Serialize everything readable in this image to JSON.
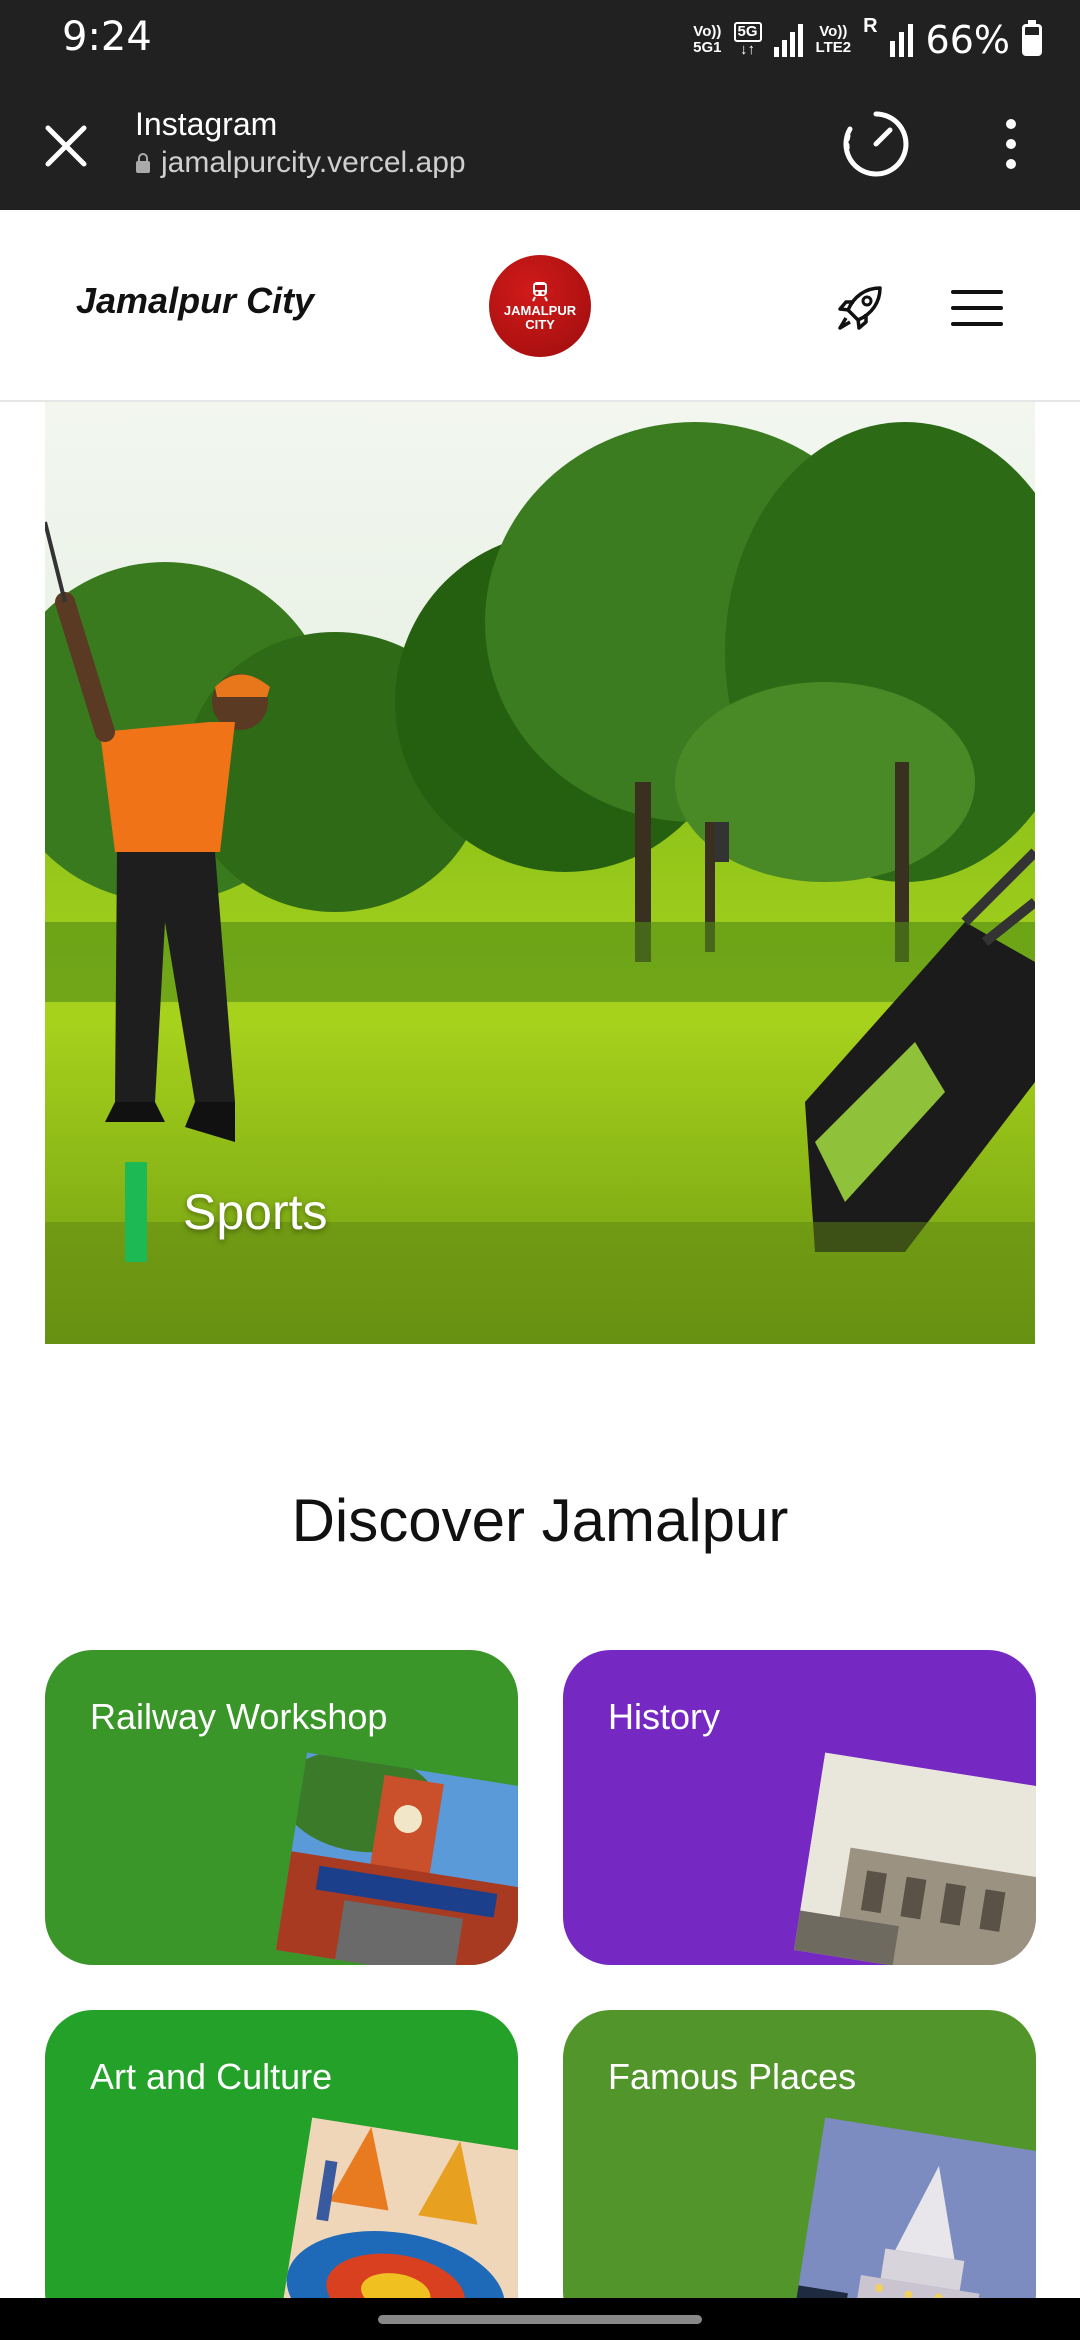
{
  "status": {
    "time": "9:24",
    "net1_top": "Vo))",
    "net1_bottom": "5G1",
    "net2_top": "5G",
    "net2_bottom": "↓↑",
    "net3_top": "Vo))",
    "net3_bottom": "LTE2",
    "roaming": "R",
    "battery": "66%"
  },
  "browser": {
    "title": "Instagram",
    "url": "jamalpurcity.vercel.app"
  },
  "header": {
    "brand": "Jamalpur City",
    "logo_line1": "JAMALPUR",
    "logo_line2": "CITY",
    "brand_color": "#b31212"
  },
  "hero": {
    "label": "Sports",
    "accent": "#1db954"
  },
  "discover": {
    "title": "Discover Jamalpur",
    "cards": [
      {
        "label": "Railway Workshop",
        "color": "#3a9629"
      },
      {
        "label": "History",
        "color": "#7629c2"
      },
      {
        "label": "Art and Culture",
        "color": "#24a128"
      },
      {
        "label": "Famous Places",
        "color": "#52962b"
      }
    ]
  }
}
